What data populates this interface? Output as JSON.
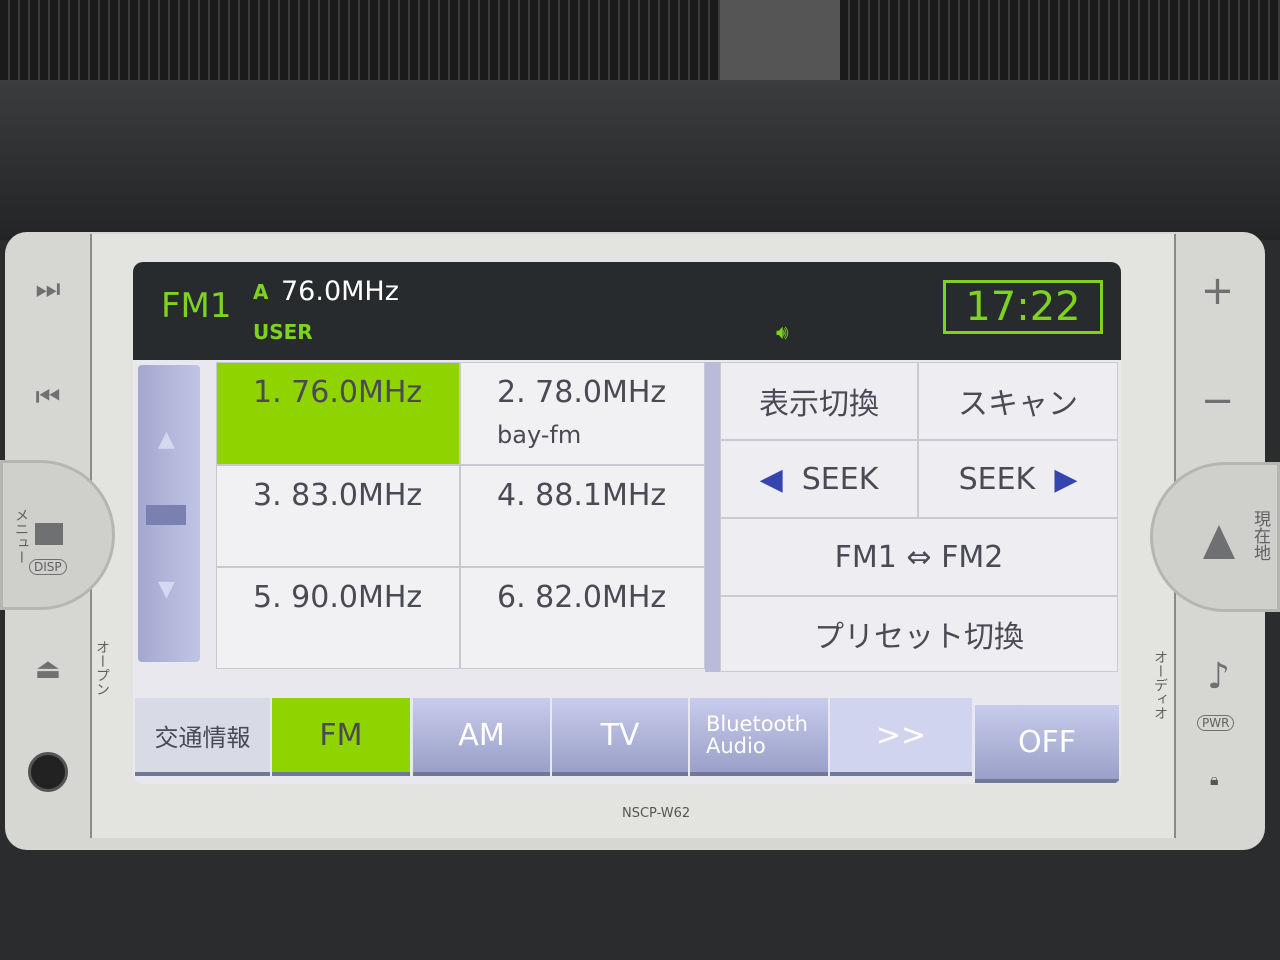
{
  "header": {
    "band": "FM1",
    "frequency": "76.0MHz",
    "mode": "USER",
    "clock": "17:22",
    "antenna_icon": "antenna-icon",
    "speaker_icon": "speaker-icon"
  },
  "presets": [
    {
      "label": "1. 76.0MHz",
      "station": "",
      "selected": true
    },
    {
      "label": "2. 78.0MHz",
      "station": "bay-fm",
      "selected": false
    },
    {
      "label": "3. 83.0MHz",
      "station": "",
      "selected": false
    },
    {
      "label": "4. 88.1MHz",
      "station": "",
      "selected": false
    },
    {
      "label": "5. 90.0MHz",
      "station": "",
      "selected": false
    },
    {
      "label": "6. 82.0MHz",
      "station": "",
      "selected": false
    }
  ],
  "controls": {
    "display_switch": "表示切換",
    "scan": "スキャン",
    "seek_back": "SEEK",
    "seek_forward": "SEEK",
    "band_toggle": "FM1 ⇔ FM2",
    "preset_switch": "プリセット切換"
  },
  "tabs": [
    {
      "label": "交通情報",
      "active": false
    },
    {
      "label": "FM",
      "active": true
    },
    {
      "label": "AM",
      "active": false
    },
    {
      "label": "TV",
      "active": false
    },
    {
      "label": "Bluetooth Audio",
      "active": false
    },
    {
      "label": ">>",
      "active": false
    },
    {
      "label": "OFF",
      "active": false
    }
  ],
  "hardware": {
    "menu": "メニュー",
    "disp": "DISP",
    "open": "オープン",
    "audio": "オーディオ",
    "current_location": "現在地",
    "pwr": "PWR",
    "model": "NSCP-W62"
  },
  "colors": {
    "accent": "#8fd400",
    "header_bg": "#282b2d",
    "header_text": "#7ed321"
  }
}
